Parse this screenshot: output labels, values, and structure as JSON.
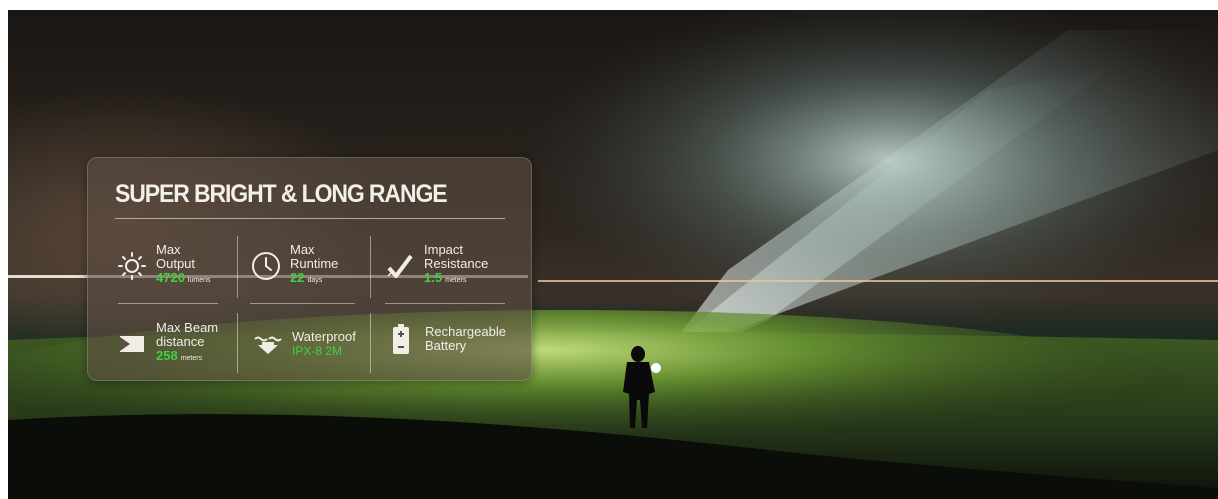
{
  "panel": {
    "title": "SUPER BRIGHT & LONG RANGE",
    "features": [
      {
        "label1": "Max",
        "label2": "Output",
        "value": "4720",
        "unit": "lumens",
        "icon": "sun-icon"
      },
      {
        "label1": "Max",
        "label2": "Runtime",
        "value": "22",
        "unit": "days",
        "icon": "clock-icon"
      },
      {
        "label1": "Impact",
        "label2": "Resistance",
        "value": "1.5",
        "unit": "meters",
        "icon": "impact-check-icon"
      },
      {
        "label1": "Max Beam",
        "label2": "distance",
        "value": "258",
        "unit": "meters",
        "icon": "beam-distance-icon"
      },
      {
        "label1": "Waterproof",
        "label2": "",
        "value": "IPX-8 2M",
        "unit": "",
        "icon": "water-drop-arrow-icon"
      },
      {
        "label1": "Rechargeable",
        "label2": "Battery",
        "value": "",
        "unit": "",
        "icon": "battery-icon"
      }
    ]
  },
  "colors": {
    "accent_green": "#3fd13f",
    "text": "#f1ede7",
    "panel_bg": "#5c4e42"
  }
}
